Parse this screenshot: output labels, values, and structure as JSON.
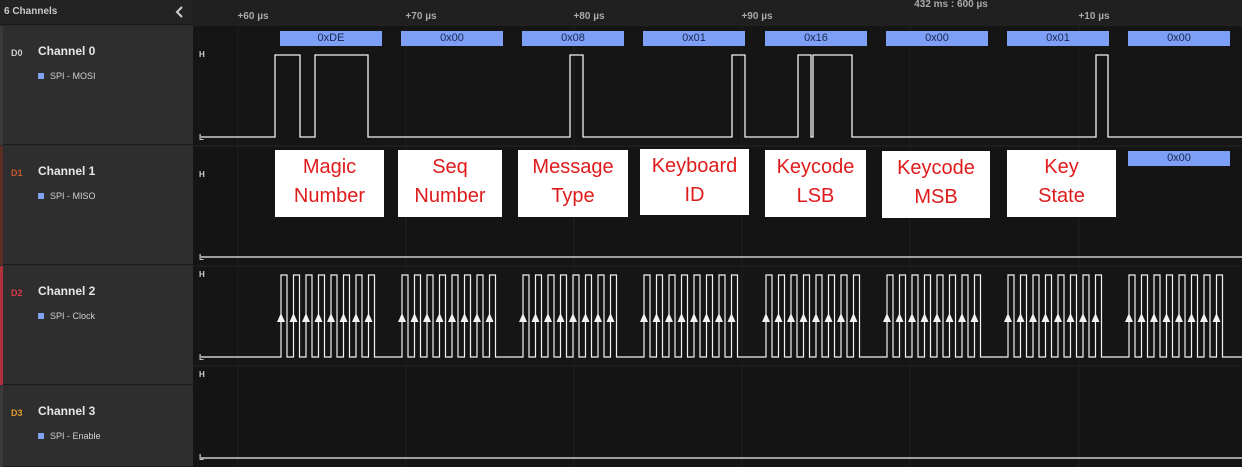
{
  "sidebar": {
    "header": {
      "title": "6 Channels",
      "collapse_icon": "chevron-left-icon"
    },
    "channels": [
      {
        "id": "D0",
        "name": "Channel 0",
        "analyzer": "SPI - MOSI",
        "color": "#cfcfcf",
        "stripe": "#3a3a3a"
      },
      {
        "id": "D1",
        "name": "Channel 1",
        "analyzer": "SPI - MISO",
        "color": "#c9582e",
        "stripe": "#5a2e24"
      },
      {
        "id": "D2",
        "name": "Channel 2",
        "analyzer": "SPI - Clock",
        "color": "#d9384a",
        "stripe": "#b0303d"
      },
      {
        "id": "D3",
        "name": "Channel 3",
        "analyzer": "SPI - Enable",
        "color": "#e49a2d",
        "stripe": "#3a3a3a"
      }
    ]
  },
  "timeline": {
    "ticks": [
      "+60 µs",
      "+70 µs",
      "+80 µs",
      "+90 µs",
      "+10 µs"
    ],
    "cursor_time": "432 ms : 600 µs"
  },
  "level_labels": {
    "high": "H",
    "low": "L"
  },
  "mosi_bytes": [
    "0xDE",
    "0x00",
    "0x08",
    "0x01",
    "0x16",
    "0x00",
    "0x01",
    "0x00"
  ],
  "miso_bytes": [
    "0x00"
  ],
  "annotations": [
    {
      "line1": "Magic",
      "line2": "Number"
    },
    {
      "line1": "Seq",
      "line2": "Number"
    },
    {
      "line1": "Message",
      "line2": "Type"
    },
    {
      "line1": "Keyboard",
      "line2": "ID"
    },
    {
      "line1": "Keycode",
      "line2": "LSB"
    },
    {
      "line1": "Keycode",
      "line2": "MSB"
    },
    {
      "line1": "Key",
      "line2": "State"
    }
  ],
  "colors": {
    "bubble": "#7d9ff5",
    "annotation_text": "#e01b1b",
    "signal": "#ffffff"
  }
}
